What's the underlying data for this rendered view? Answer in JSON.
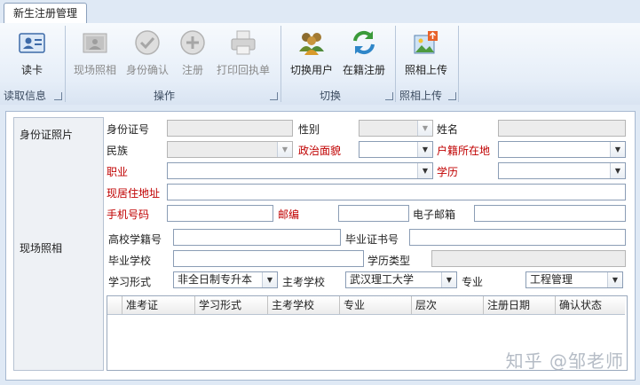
{
  "tab": {
    "title": "新生注册管理"
  },
  "ribbon": {
    "buttons": [
      {
        "label": "读卡",
        "icon": "id-card-icon",
        "enabled": true
      },
      {
        "label": "现场照相",
        "icon": "camera-icon",
        "enabled": false
      },
      {
        "label": "身份确认",
        "icon": "check-circle-icon",
        "enabled": false
      },
      {
        "label": "注册",
        "icon": "plus-circle-icon",
        "enabled": false
      },
      {
        "label": "打印回执单",
        "icon": "printer-icon",
        "enabled": false
      },
      {
        "label": "切换用户",
        "icon": "users-icon",
        "enabled": true
      },
      {
        "label": "在籍注册",
        "icon": "refresh-icon",
        "enabled": true
      },
      {
        "label": "照相上传",
        "icon": "photo-upload-icon",
        "enabled": true
      }
    ],
    "groups": [
      "读取信息",
      "操作",
      "切换",
      "照相上传"
    ]
  },
  "photo_panel": {
    "id_photo_label": "身份证照片",
    "live_photo_label": "现场照相"
  },
  "form": {
    "id_number": {
      "label": "身份证号",
      "value": ""
    },
    "gender": {
      "label": "性别",
      "value": ""
    },
    "name": {
      "label": "姓名",
      "value": ""
    },
    "ethnicity": {
      "label": "民族",
      "value": ""
    },
    "political_status": {
      "label": "政治面貌",
      "value": ""
    },
    "hukou_location": {
      "label": "户籍所在地",
      "value": ""
    },
    "occupation": {
      "label": "职业",
      "value": ""
    },
    "education": {
      "label": "学历",
      "value": ""
    },
    "current_address": {
      "label": "现居住地址",
      "value": ""
    },
    "phone": {
      "label": "手机号码",
      "value": ""
    },
    "postal_code": {
      "label": "邮编",
      "value": ""
    },
    "email": {
      "label": "电子邮箱",
      "value": ""
    },
    "college_student_id": {
      "label": "高校学籍号",
      "value": ""
    },
    "diploma_number": {
      "label": "毕业证书号",
      "value": ""
    },
    "graduate_school": {
      "label": "毕业学校",
      "value": ""
    },
    "education_type": {
      "label": "学历类型",
      "value": ""
    },
    "study_mode": {
      "label": "学习形式",
      "value": "非全日制专升本"
    },
    "host_school": {
      "label": "主考学校",
      "value": "武汉理工大学"
    },
    "major": {
      "label": "专业",
      "value": "工程管理"
    }
  },
  "grid": {
    "columns": [
      "准考证",
      "学习形式",
      "主考学校",
      "专业",
      "层次",
      "注册日期",
      "确认状态"
    ]
  },
  "watermark": "知乎 @邹老师",
  "colors": {
    "required_label": "#c00000",
    "ribbon_bg": "#e6eef8"
  }
}
